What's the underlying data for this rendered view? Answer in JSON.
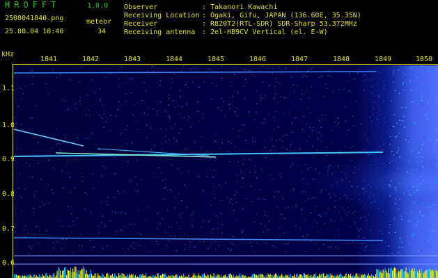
{
  "header": {
    "app_title": "HROFFT",
    "version": "1.0.0",
    "filename": "2508041840.png",
    "datetime": "25.08.04 18:40",
    "meteor_label": "meteor",
    "meteor_count": "34"
  },
  "info": [
    {
      "label": "Observer",
      "value": ": Takanori Kawachi"
    },
    {
      "label": "Receiving Location",
      "value": ": Ogaki, Gifu, JAPAN (136.60E, 35.35N)"
    },
    {
      "label": "Receiver",
      "value": ": R820T2(RTL-SDR) SDR-Sharp 53.372MHz"
    },
    {
      "label": "Receiving antenna",
      "value": ": 2el-HB9CV Vertical (el. E-W)"
    }
  ],
  "axes": {
    "y_unit": "kHz",
    "y_ticks": [
      "1.1",
      "1.0",
      "0.9",
      "0.8",
      "0.7",
      "0.6"
    ],
    "x_ticks": [
      "1841",
      "1842",
      "1843",
      "1844",
      "1845",
      "1846",
      "1847",
      "1848",
      "1849",
      "1850"
    ]
  },
  "colors": {
    "label_yellow": "#e8e800",
    "title_green": "#18c818",
    "background_dark_blue": "#000048",
    "signal_cyan": "#40c8ff",
    "noise_blue": "#3a5ce8"
  }
}
